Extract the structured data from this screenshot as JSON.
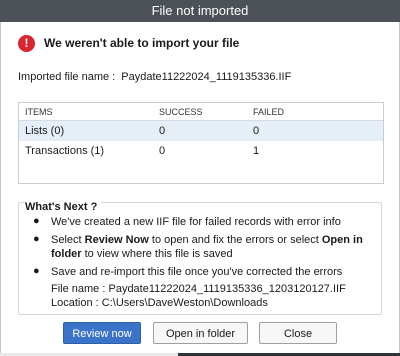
{
  "window": {
    "title": "File not imported"
  },
  "error": {
    "icon": "exclamation-icon",
    "icon_glyph": "!",
    "message": "We weren't able to import your file"
  },
  "imported_file": {
    "label": "Imported file name :",
    "value": "Paydate11222024_1119135336.IIF"
  },
  "results": {
    "headers": [
      "ITEMS",
      "SUCCESS",
      "FAILED"
    ],
    "rows": [
      {
        "item": "Lists (0)",
        "success": "0",
        "failed": "0"
      },
      {
        "item": "Transactions (1)",
        "success": "0",
        "failed": "1"
      }
    ]
  },
  "whats_next": {
    "heading": "What's Next ?",
    "bullets": [
      {
        "parts": [
          "We've created a new IIF file for failed records with error info"
        ]
      },
      {
        "parts": [
          "Select ",
          "Review Now",
          " to open and fix the errors or select ",
          "Open in folder",
          " to view where this file is saved"
        ]
      },
      {
        "parts": [
          "Save and re-import this file once you've corrected the errors"
        ]
      }
    ],
    "file_name_label": "File name :",
    "file_name_value": "Paydate11222024_1119135336_1203120127.IIF",
    "location_label": "Location  :",
    "location_value": "C:\\Users\\DaveWeston\\Downloads"
  },
  "buttons": {
    "review": "Review now",
    "open_folder": "Open in folder",
    "close": "Close"
  },
  "colors": {
    "titlebar": "#4c5158",
    "error": "#d8252f",
    "primary": "#3b73c8",
    "row_highlight": "#e6eef8"
  }
}
